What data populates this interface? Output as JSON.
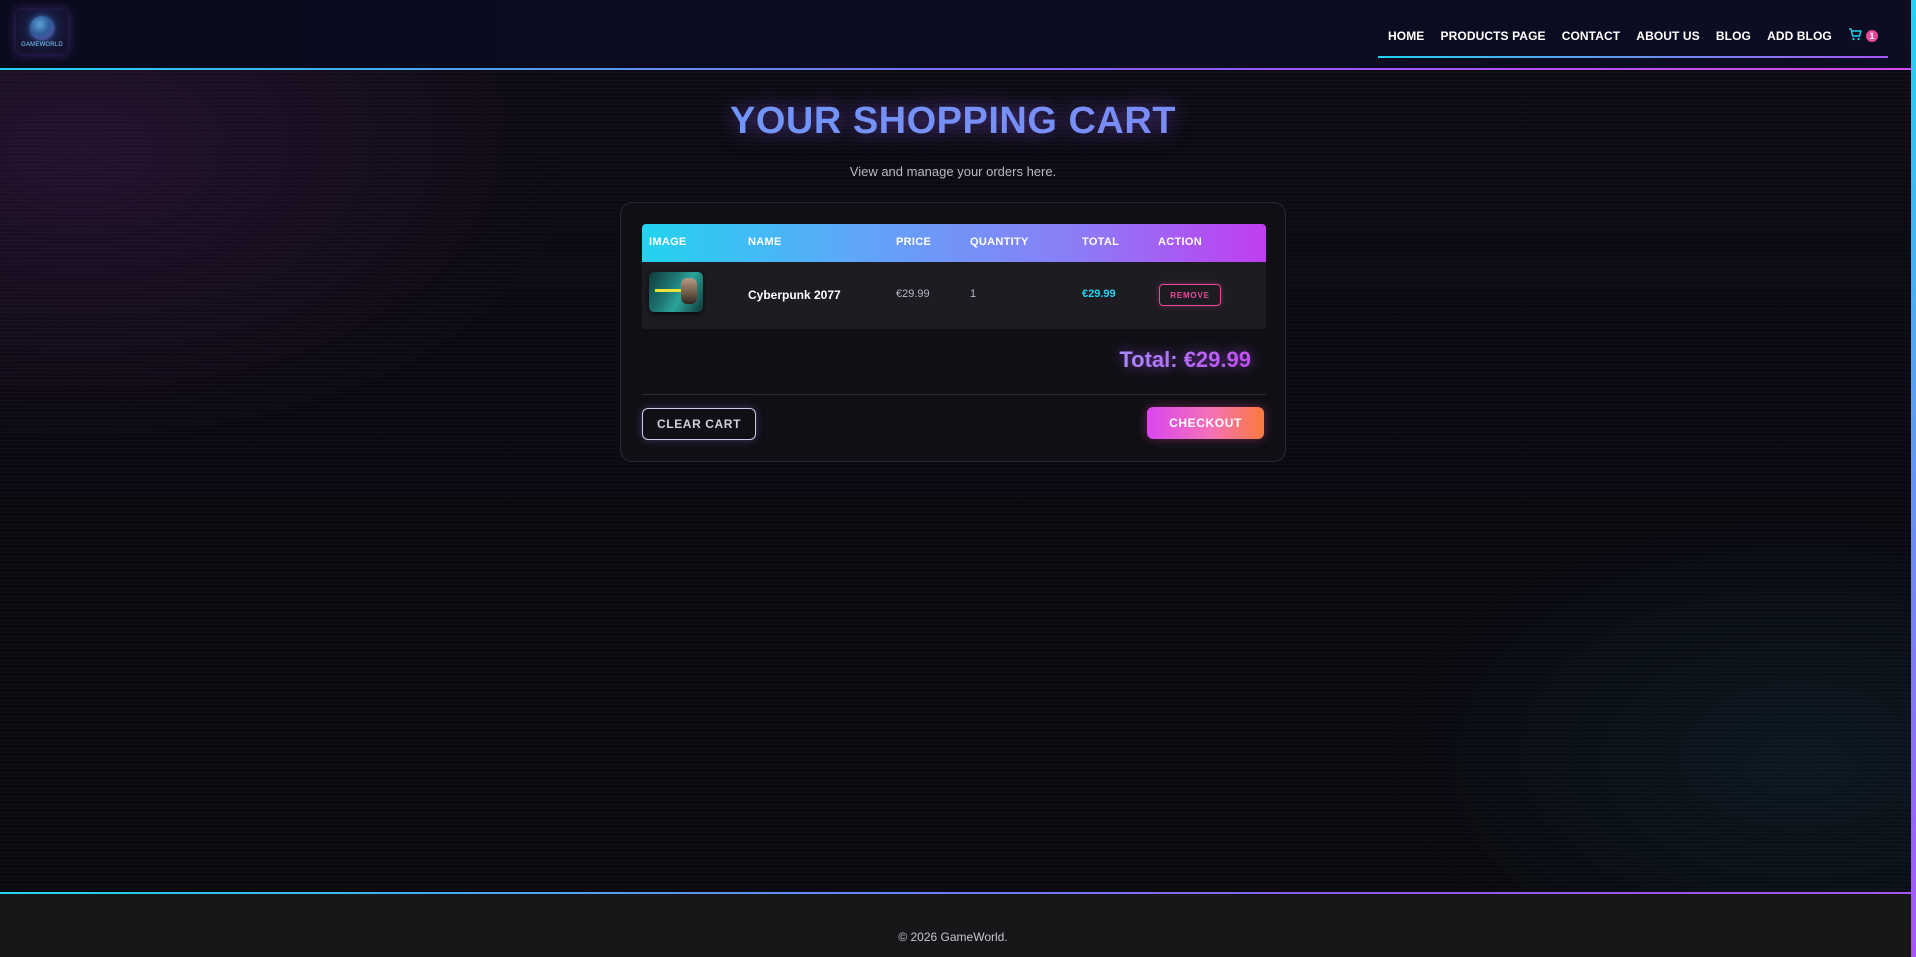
{
  "brand": {
    "logo_text": "GAMEWORLD",
    "logo_icon": "globe-icon"
  },
  "nav": {
    "items": [
      {
        "label": "HOME"
      },
      {
        "label": "PRODUCTS PAGE"
      },
      {
        "label": "CONTACT"
      },
      {
        "label": "ABOUT US"
      },
      {
        "label": "BLOG"
      },
      {
        "label": "ADD BLOG"
      }
    ],
    "cart_icon": "cart-icon",
    "cart_count": "1"
  },
  "page": {
    "title": "YOUR SHOPPING CART",
    "subtitle": "View and manage your orders here."
  },
  "cart": {
    "columns": [
      "IMAGE",
      "NAME",
      "PRICE",
      "QUANTITY",
      "TOTAL",
      "ACTION"
    ],
    "items": [
      {
        "name": "Cyberpunk 2077",
        "price": "€29.99",
        "quantity": "1",
        "total": "€29.99",
        "action_label": "REMOVE"
      }
    ],
    "grand_total": "Total: €29.99",
    "clear_label": "CLEAR CART",
    "checkout_label": "CHECKOUT"
  },
  "footer": {
    "text": "© 2026 GameWorld."
  },
  "colors": {
    "accent_cyan": "#22d3ee",
    "accent_purple": "#a855f7",
    "accent_pink": "#ec4899",
    "accent_orange": "#fb7a3c"
  }
}
